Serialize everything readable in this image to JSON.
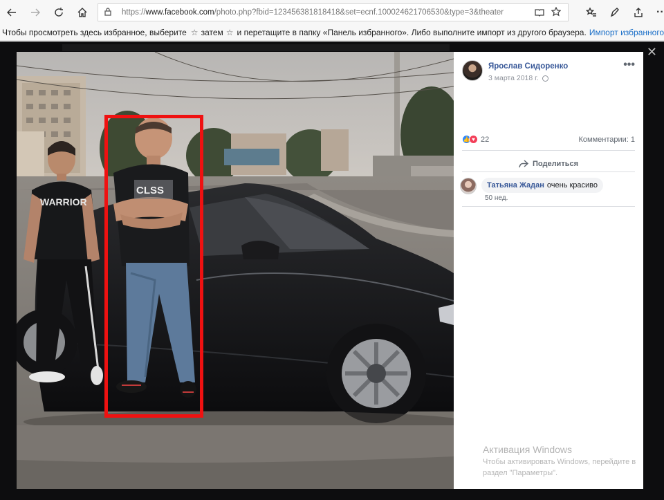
{
  "browser": {
    "url_prefix": "https://",
    "url_domain": "www.facebook.com",
    "url_path": "/photo.php?fbid=123456381818418&set=ecnf.100024621706530&type=3&theater",
    "back_icon": "arrow-left-icon",
    "forward_icon": "arrow-right-icon",
    "refresh_icon": "refresh-icon",
    "home_icon": "home-icon"
  },
  "favorites_bar": {
    "text_before": "Чтобы просмотреть здесь избранное, выберите",
    "star1": "☆",
    "text_middle": "затем",
    "star2": "☆",
    "text_after": "и перетащите в папку «Панель избранного». Либо выполните импорт из другого браузера.",
    "import_link": "Импорт избранного"
  },
  "post": {
    "author": "Ярослав Сидоренко",
    "date": "3 марта 2018 г.",
    "more": "•••",
    "reaction_count": "22",
    "comments_label": "Комментарии: 1",
    "share_label": "Поделиться"
  },
  "comment": {
    "author": "Татьяна Жадан",
    "text": "очень красиво",
    "time": "50 нед."
  },
  "watermark": {
    "title": "Активация Windows",
    "line1": "Чтобы активировать Windows, перейдите в",
    "line2": "раздел \"Параметры\"."
  },
  "photo": {
    "shirt_left": "WARRIOR",
    "shirt_right": "CLSS",
    "highlight_color": "#ef1111"
  },
  "overlay": {
    "close": "✕"
  }
}
